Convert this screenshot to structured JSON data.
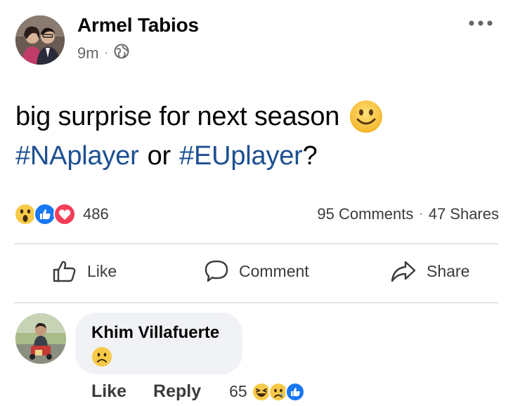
{
  "post": {
    "author": "Armel Tabios",
    "time": "9m",
    "separator": "·",
    "privacy_icon": "globe-icon",
    "more_icon": "more-horizontal-icon",
    "text_line1": "big surprise for next season",
    "hashtag1": "#NAplayer",
    "connector": "or",
    "hashtag2": "#EUplayer",
    "question_mark": "?",
    "emoji": "slightly-smiling-face"
  },
  "stats": {
    "reaction_icons": [
      "wow-reaction-icon",
      "like-reaction-icon",
      "love-reaction-icon"
    ],
    "reaction_count": "486",
    "comments": "95 Comments",
    "separator": "·",
    "shares": "47 Shares"
  },
  "actions": {
    "like": "Like",
    "comment": "Comment",
    "share": "Share"
  },
  "comment": {
    "author": "Khim Villafuerte",
    "emoji": "frowning-face",
    "like": "Like",
    "reply": "Reply",
    "reaction_count": "65",
    "reaction_icons": [
      "haha-reaction-icon",
      "sad-reaction-icon",
      "like-reaction-icon"
    ]
  },
  "colors": {
    "hashtag": "#1d4f91",
    "secondary_text": "#65676b",
    "divider": "#e4e6eb",
    "bubble": "#f0f2f5",
    "like_blue": "#1877f2",
    "love_red": "#f33e58",
    "emoji_yellow": "#f7c948"
  }
}
